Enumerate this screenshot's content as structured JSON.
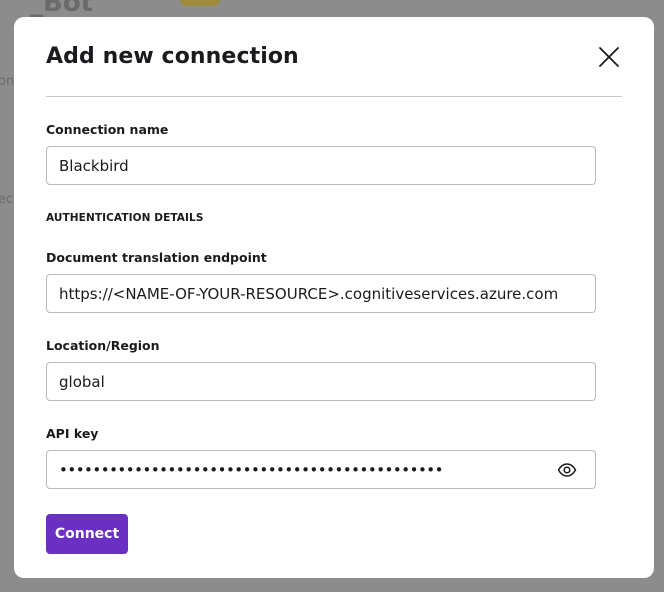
{
  "background": {
    "title_fragment": "_Bot",
    "side_fragment_1": "on",
    "side_fragment_2": "ec"
  },
  "modal": {
    "title": "Add new connection",
    "connection_name": {
      "label": "Connection name",
      "value": "Blackbird"
    },
    "auth_section_label": "AUTHENTICATION DETAILS",
    "endpoint": {
      "label": "Document translation endpoint",
      "value": "https://<NAME-OF-YOUR-RESOURCE>.cognitiveservices.azure.com"
    },
    "region": {
      "label": "Location/Region",
      "value": "global"
    },
    "api_key": {
      "label": "API key",
      "value": "••••••••••••••••••••••••••••••••••••••••••••••"
    },
    "connect_label": "Connect"
  },
  "colors": {
    "accent": "#6a2fc3",
    "overlay": "#8c8c8c",
    "border": "#b9b9bf"
  },
  "icons": {
    "close": "close-icon",
    "visibility": "eye-icon"
  }
}
